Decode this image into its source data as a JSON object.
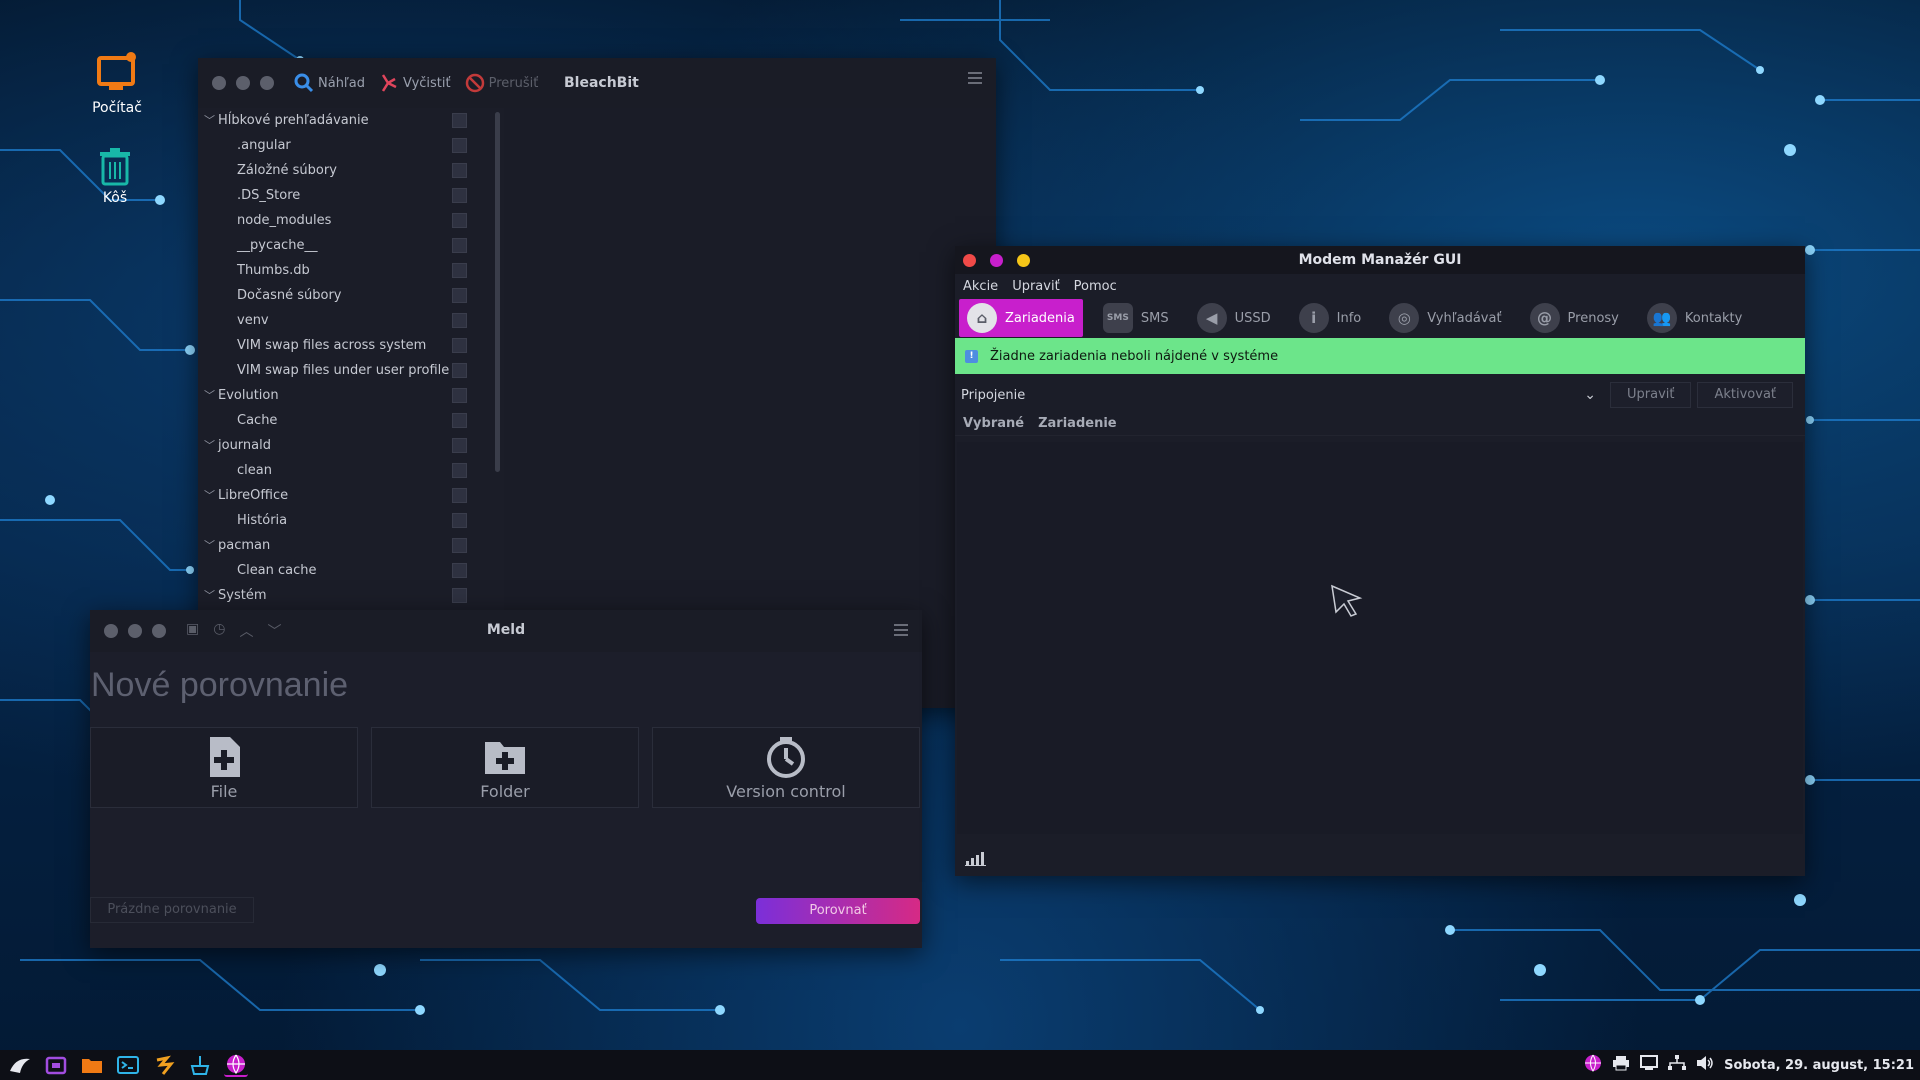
{
  "desktop": {
    "icons": [
      {
        "label": "Počítač",
        "icon": "computer-icon"
      },
      {
        "label": "Kôš",
        "icon": "trash-icon"
      }
    ]
  },
  "bleachbit": {
    "title": "BleachBit",
    "toolbar": {
      "preview": "Náhľad",
      "clean": "Vyčistiť",
      "abort": "Prerušiť"
    },
    "tree": [
      {
        "label": "Hĺbkové prehľadávanie",
        "level": 0
      },
      {
        "label": ".angular",
        "level": 1
      },
      {
        "label": "Záložné súbory",
        "level": 1
      },
      {
        "label": ".DS_Store",
        "level": 1
      },
      {
        "label": "node_modules",
        "level": 1
      },
      {
        "label": "__pycache__",
        "level": 1
      },
      {
        "label": "Thumbs.db",
        "level": 1
      },
      {
        "label": "Dočasné súbory",
        "level": 1
      },
      {
        "label": "venv",
        "level": 1
      },
      {
        "label": "VIM swap files across system",
        "level": 1
      },
      {
        "label": "VIM swap files under user profile",
        "level": 1
      },
      {
        "label": "Evolution",
        "level": 0
      },
      {
        "label": "Cache",
        "level": 1
      },
      {
        "label": "journald",
        "level": 0
      },
      {
        "label": "clean",
        "level": 1
      },
      {
        "label": "LibreOffice",
        "level": 0
      },
      {
        "label": "História",
        "level": 1
      },
      {
        "label": "pacman",
        "level": 0
      },
      {
        "label": "Clean cache",
        "level": 1
      },
      {
        "label": "Systém",
        "level": 0
      }
    ]
  },
  "meld": {
    "title": "Meld",
    "heading": "Nové porovnanie",
    "cards": [
      {
        "label": "File",
        "icon": "file-add-icon"
      },
      {
        "label": "Folder",
        "icon": "folder-add-icon"
      },
      {
        "label": "Version control",
        "icon": "version-control-icon"
      }
    ],
    "empty_label": "Prázdne porovnanie",
    "compare_label": "Porovnať"
  },
  "modem": {
    "title": "Modem Manažér GUI",
    "menu": [
      "Akcie",
      "Upraviť",
      "Pomoc"
    ],
    "tools": [
      {
        "label": "Zariadenia",
        "icon": "home-icon",
        "active": true
      },
      {
        "label": "SMS",
        "icon": "sms-icon"
      },
      {
        "label": "USSD",
        "icon": "ussd-icon"
      },
      {
        "label": "Info",
        "icon": "info-icon"
      },
      {
        "label": "Vyhľadávať",
        "icon": "scan-icon"
      },
      {
        "label": "Prenosy",
        "icon": "traffic-icon"
      },
      {
        "label": "Kontakty",
        "icon": "contacts-icon"
      }
    ],
    "info_message": "Žiadne zariadenia neboli nájdené v systéme",
    "connection_label": "Pripojenie",
    "edit_button": "Upraviť",
    "activate_button": "Aktivovať",
    "columns": [
      "Vybrané",
      "Zariadenie"
    ]
  },
  "taskbar": {
    "clock": "Sobota, 29. august, 15:21",
    "colors": {
      "accent": "#c81fcc",
      "info_bar": "#6ce58a"
    }
  }
}
